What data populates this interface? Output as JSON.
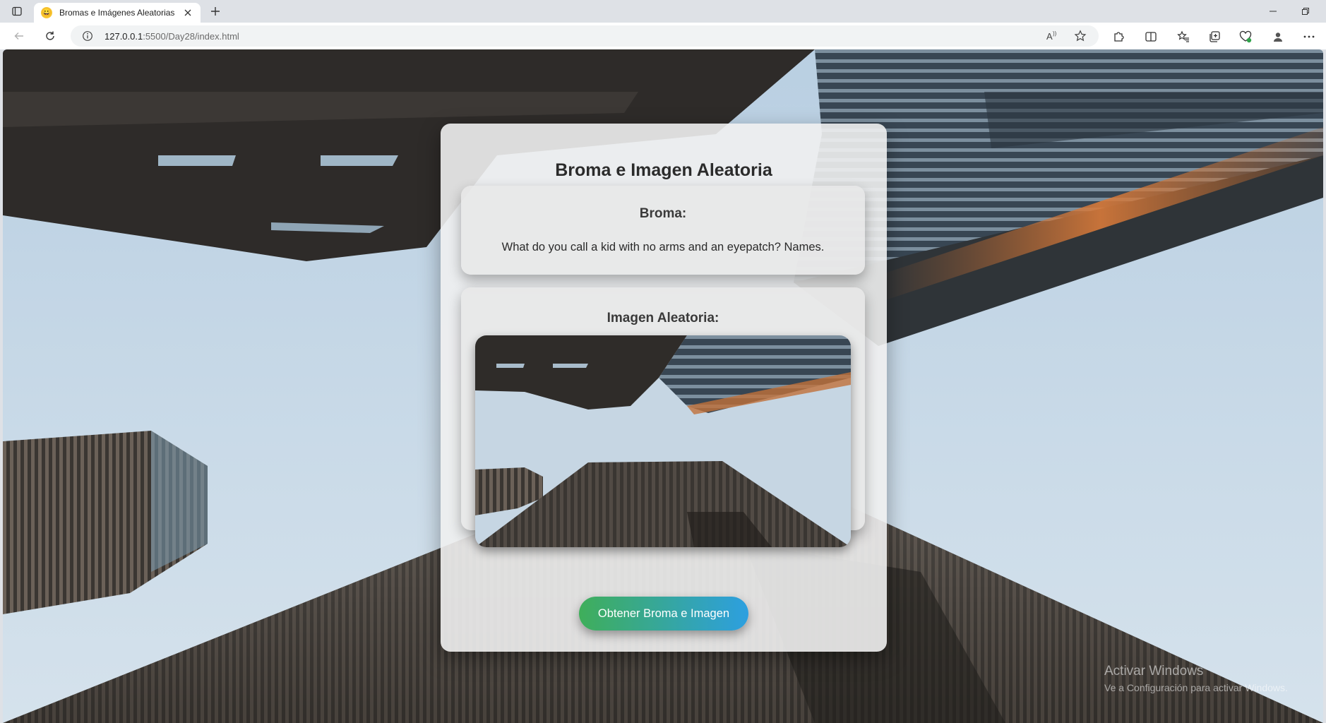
{
  "browser": {
    "tab": {
      "favicon": "😀",
      "title": "Bromas e Imágenes Aleatorias"
    },
    "address": {
      "host": "127.0.0.1",
      "path": ":5500/Day28/index.html"
    },
    "icons": {
      "tab_actions": "tab-actions-icon",
      "close_tab": "close-icon",
      "new_tab": "plus-icon",
      "back": "back-arrow-icon",
      "reload": "reload-icon",
      "site_info": "info-icon",
      "read_aloud": "read-aloud-icon",
      "favorite": "star-icon",
      "extensions": "puzzle-icon",
      "split_screen": "split-screen-icon",
      "favorites": "favorites-icon",
      "collections": "collections-icon",
      "browser_essentials": "heart-pulse-icon",
      "profile": "profile-icon",
      "menu": "more-icon"
    }
  },
  "page": {
    "title": "Broma e Imagen Aleatoria",
    "joke": {
      "heading": "Broma:",
      "text": "What do you call a kid with no arms and an eyepatch? Names."
    },
    "image": {
      "heading": "Imagen Aleatoria:"
    },
    "button": {
      "label": "Obtener Broma e Imagen"
    }
  },
  "watermark": {
    "title": "Activar Windows",
    "subtitle": "Ve a Configuración para activar Windows."
  },
  "colors": {
    "button_gradient_start": "#3fae5a",
    "button_gradient_end": "#2d9fe0",
    "sky": "#c4d6e5"
  }
}
